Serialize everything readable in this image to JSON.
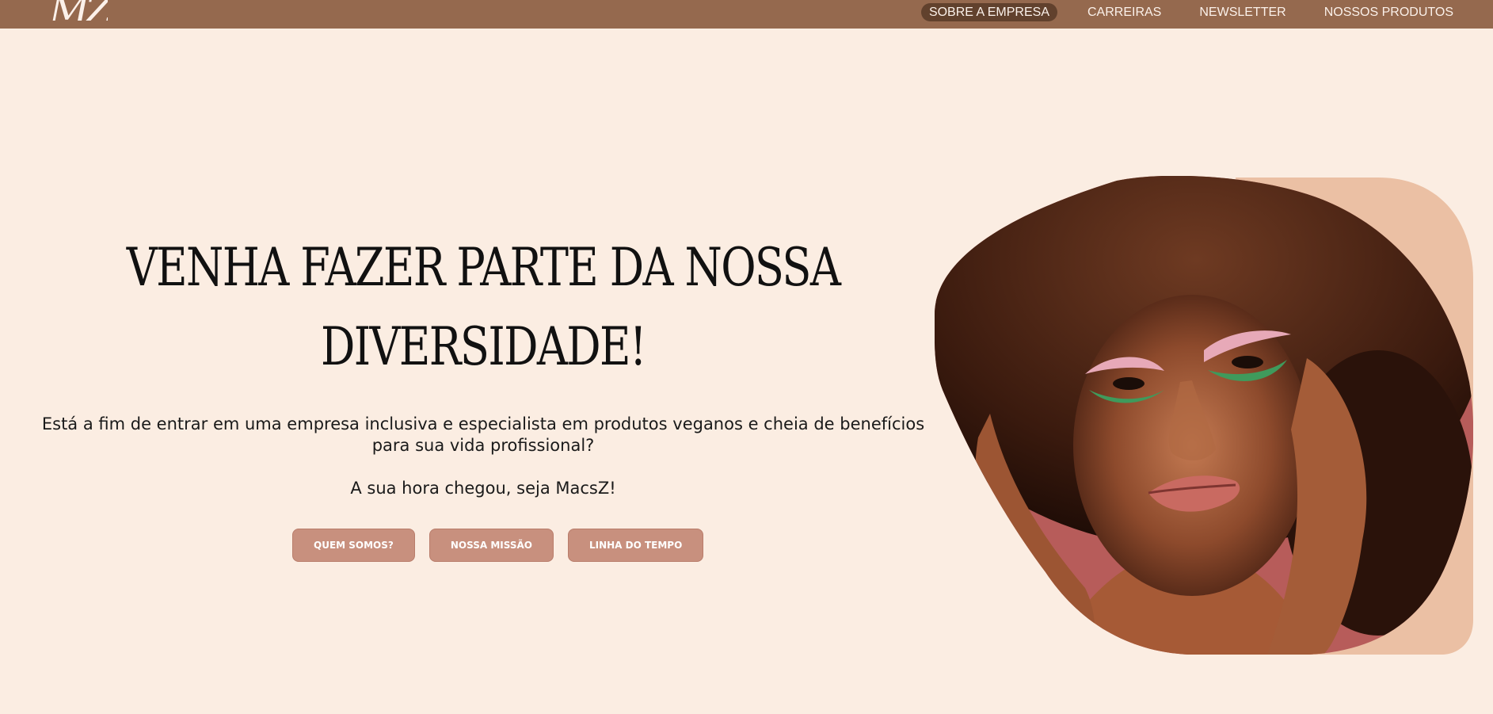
{
  "header": {
    "logo_text": "MZ",
    "nav": [
      {
        "label": "SOBRE A EMPRESA",
        "active": true
      },
      {
        "label": "CARREIRAS",
        "active": false
      },
      {
        "label": "NEWSLETTER",
        "active": false
      },
      {
        "label": "NOSSOS PRODUTOS",
        "active": false
      }
    ]
  },
  "hero": {
    "headline_line1": "VENHA FAZER PARTE DA NOSSA",
    "headline_line2": "DIVERSIDADE!",
    "description": "Está a fim de entrar em uma empresa inclusiva e especialista em produtos veganos e cheia de benefícios para sua vida profissional?",
    "tagline": "A sua hora chegou, seja MacsZ!",
    "buttons": [
      {
        "label": "QUEM SOMOS?"
      },
      {
        "label": "NOSSA MISSÃO"
      },
      {
        "label": "LINHA DO TEMPO"
      }
    ],
    "image_icon": "portrait-photo-icon"
  },
  "colors": {
    "background": "#fbede2",
    "nav_bar": "#95694e",
    "nav_active": "#61412d",
    "button": "#c8907e",
    "blob_back": "#ebc0a4"
  }
}
